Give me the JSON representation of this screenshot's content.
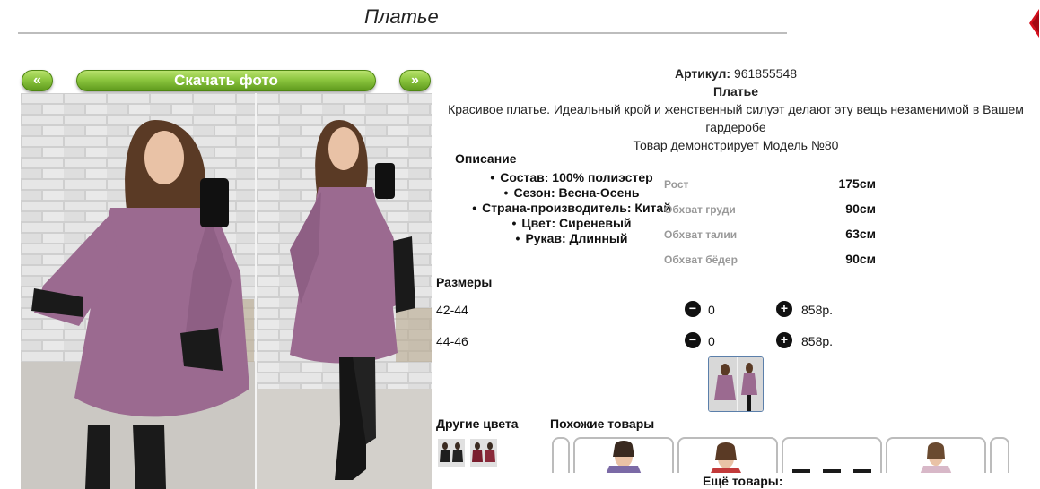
{
  "page_title": "Платье",
  "gallery": {
    "prev_label": "«",
    "download_label": "Скачать фото",
    "next_label": "»"
  },
  "product": {
    "article_label": "Артикул:",
    "article_value": "961855548",
    "name": "Платье",
    "description": "Красивое платье. Идеальный крой и женственный силуэт делают эту вещь незаменимой в Вашем гардеробе",
    "model_note": "Товар демонстрирует Модель №80"
  },
  "details": {
    "title": "Описание",
    "items": [
      "Состав: 100% полиэстер",
      "Сезон: Весна-Осень",
      "Страна-производитель: Китай",
      "Цвет: Сиреневый",
      "Рукав: Длинный"
    ]
  },
  "measurements": [
    {
      "label": "Рост",
      "value": "175см"
    },
    {
      "label": "Обхват груди",
      "value": "90см"
    },
    {
      "label": "Обхват талии",
      "value": "63см"
    },
    {
      "label": "Обхват бёдер",
      "value": "90см"
    }
  ],
  "sizes": {
    "title": "Размеры",
    "minus_glyph": "−",
    "plus_glyph": "+",
    "rows": [
      {
        "size": "42-44",
        "qty": "0",
        "price": "858р."
      },
      {
        "size": "44-46",
        "qty": "0",
        "price": "858р."
      }
    ]
  },
  "other_colors_title": "Другие цвета",
  "similar_title": "Похожие товары",
  "more_label": "Ещё товары:",
  "colors": {
    "dress": "#9b6a90",
    "accent_green": "#8cc63f",
    "close_red": "#d4111e"
  },
  "icons": [
    "close-icon",
    "minus-circle-icon",
    "plus-circle-icon"
  ]
}
